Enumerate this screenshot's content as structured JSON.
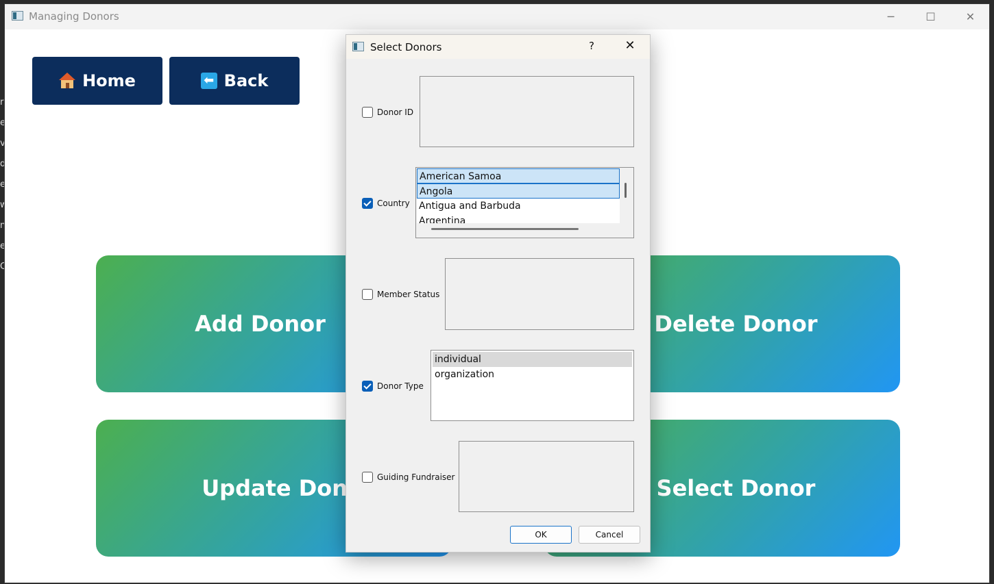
{
  "main_window": {
    "title": "Managing Donors",
    "controls": {
      "minimize": "─",
      "maximize": "☐",
      "close": "✕"
    },
    "nav": {
      "home_label": "Home",
      "back_label": "Back"
    },
    "cards": {
      "add": "Add Donor",
      "delete": "Delete Donor",
      "update": "Update Donor",
      "select": "Select Donor"
    }
  },
  "dialog": {
    "title": "Select Donors",
    "help": "?",
    "close": "✕",
    "filters": {
      "donor_id": {
        "label": "Donor ID",
        "checked": false
      },
      "country": {
        "label": "Country",
        "checked": true,
        "options": [
          "American Samoa",
          "Angola",
          "Antigua and Barbuda",
          "Argentina"
        ],
        "selected": [
          "American Samoa",
          "Angola"
        ]
      },
      "member_status": {
        "label": "Member Status",
        "checked": false
      },
      "donor_type": {
        "label": "Donor Type",
        "checked": true,
        "options": [
          "individual",
          "organization"
        ],
        "highlighted": "individual"
      },
      "guiding_fundraiser": {
        "label": "Guiding Fundraiser",
        "checked": false
      }
    },
    "buttons": {
      "ok": "OK",
      "cancel": "Cancel"
    }
  },
  "colors": {
    "nav_button_bg": "#0c2d5c",
    "card_gradient_start": "#4caf50",
    "card_gradient_end": "#2196f3",
    "checkbox_checked": "#0a5fb8",
    "selection_bg": "#cce4f7"
  }
}
